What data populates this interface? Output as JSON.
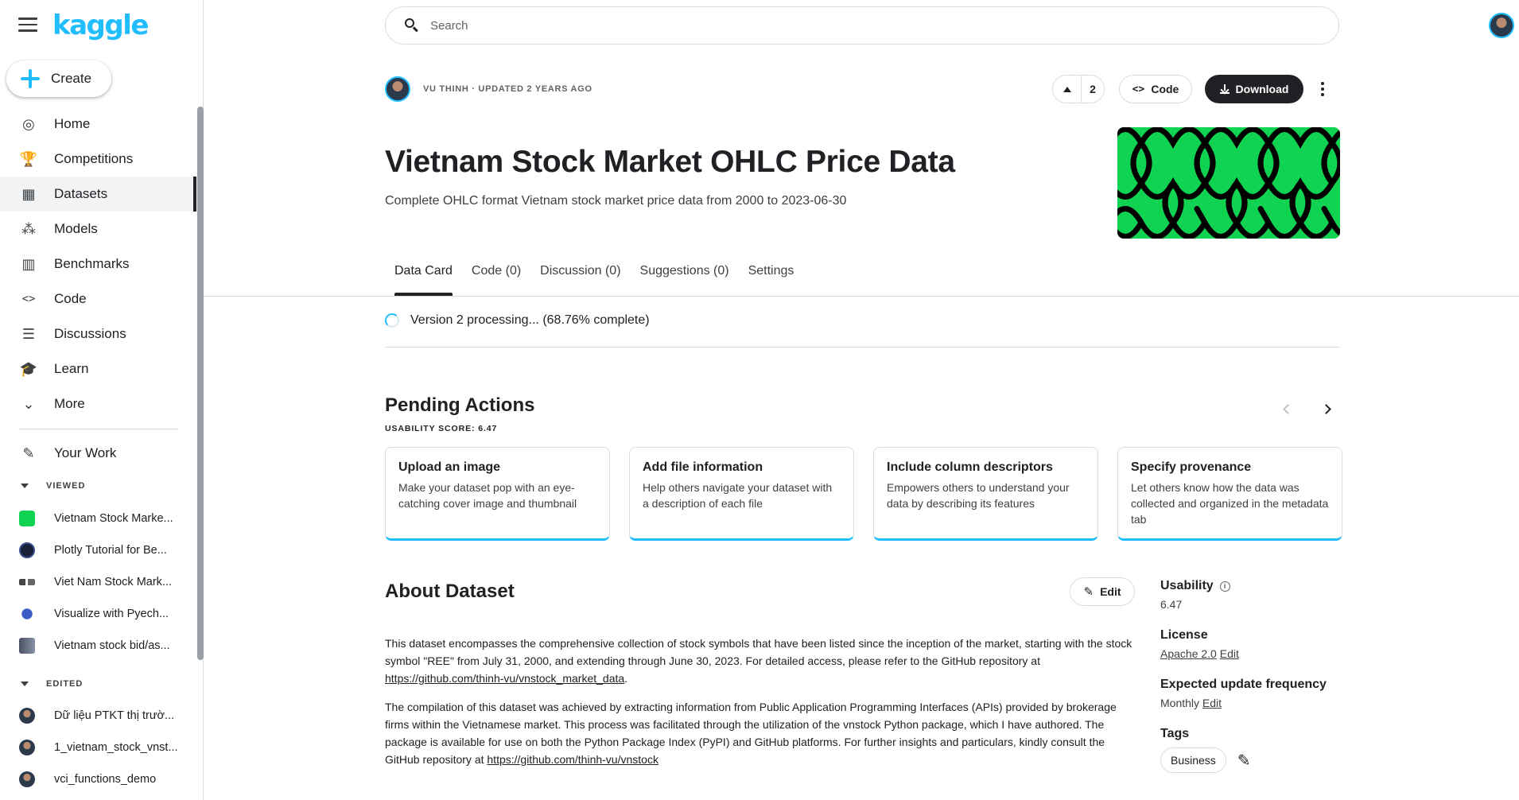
{
  "app": {
    "logo": "kaggle"
  },
  "sidebar": {
    "create_label": "Create",
    "items": [
      {
        "label": "Home",
        "icon": "compass-icon",
        "glyph": "◎"
      },
      {
        "label": "Competitions",
        "icon": "trophy-icon",
        "glyph": "🏆"
      },
      {
        "label": "Datasets",
        "icon": "table-icon",
        "glyph": "▦"
      },
      {
        "label": "Models",
        "icon": "models-icon",
        "glyph": "⁂"
      },
      {
        "label": "Benchmarks",
        "icon": "bar-chart-icon",
        "glyph": "▥"
      },
      {
        "label": "Code",
        "icon": "code-icon",
        "glyph": "<>"
      },
      {
        "label": "Discussions",
        "icon": "discussion-icon",
        "glyph": "☰"
      },
      {
        "label": "Learn",
        "icon": "school-icon",
        "glyph": "🎓"
      },
      {
        "label": "More",
        "icon": "chevron-down-icon",
        "glyph": "⌄"
      }
    ],
    "your_work": {
      "label": "Your Work",
      "icon": "notebook-edit-icon",
      "glyph": "✎"
    },
    "viewed_heading": "VIEWED",
    "viewed": [
      {
        "label": "Vietnam Stock Marke...",
        "color": "#11d352"
      },
      {
        "label": "Plotly Tutorial for Be...",
        "color": "#1a1f3a"
      },
      {
        "label": "Viet Nam Stock Mark...",
        "color": "#444"
      },
      {
        "label": "Visualize with Pyech...",
        "color": "#3b5cc4"
      },
      {
        "label": "Vietnam stock bid/as...",
        "color": "#4a5060"
      }
    ],
    "edited_heading": "EDITED",
    "edited": [
      {
        "label": "Dữ liệu PTKT thị trườ..."
      },
      {
        "label": "1_vietnam_stock_vnst..."
      },
      {
        "label": "vci_functions_demo"
      }
    ]
  },
  "search": {
    "placeholder": "Search"
  },
  "header": {
    "owner_line": "VU THINH · UPDATED 2 YEARS AGO",
    "vote_count": "2",
    "code_label": "Code",
    "download_label": "Download",
    "title": "Vietnam Stock Market OHLC Price Data",
    "subtitle": "Complete OHLC format Vietnam stock market price data from 2000 to 2023-06-30",
    "cover_color": "#11d352"
  },
  "tabs": [
    {
      "label": "Data Card"
    },
    {
      "label": "Code (0)"
    },
    {
      "label": "Discussion (0)"
    },
    {
      "label": "Suggestions (0)"
    },
    {
      "label": "Settings"
    }
  ],
  "processing": {
    "text": "Version 2 processing... (68.76% complete)"
  },
  "pending": {
    "title": "Pending Actions",
    "usability": "USABILITY SCORE: 6.47",
    "cards": [
      {
        "title": "Upload an image",
        "desc": "Make your dataset pop with an eye-catching cover image and thumbnail"
      },
      {
        "title": "Add file information",
        "desc": "Help others navigate your dataset with a description of each file"
      },
      {
        "title": "Include column descriptors",
        "desc": "Empowers others to understand your data by describing its features"
      },
      {
        "title": "Specify provenance",
        "desc": "Let others know how the data was collected and organized in the metadata tab"
      }
    ]
  },
  "about": {
    "title": "About Dataset",
    "edit_label": "Edit",
    "p1": "This dataset encompasses the comprehensive collection of stock symbols that have been listed since the inception of the market, starting with the stock symbol \"REE\" from July 31, 2000, and extending through June 30, 2023. For detailed access, please refer to the GitHub repository at ",
    "p1_link": "https://github.com/thinh-vu/vnstock_market_data",
    "p1_end": ".",
    "p2": "The compilation of this dataset was achieved by extracting information from Public Application Programming Interfaces (APIs) provided by brokerage firms within the Vietnamese market. This process was facilitated through the utilization of the vnstock Python package, which I have authored. The package is available for use on both the Python Package Index (PyPI) and GitHub platforms. For further insights and particulars, kindly consult the GitHub repository at ",
    "p2_link": "https://github.com/thinh-vu/vnstock"
  },
  "meta": {
    "usability_label": "Usability",
    "usability_value": "6.47",
    "license_label": "License",
    "license_value": "Apache 2.0",
    "license_edit": "Edit",
    "frequency_label": "Expected update frequency",
    "frequency_value": "Monthly",
    "frequency_edit": "Edit",
    "tags_label": "Tags",
    "tags": [
      "Business"
    ]
  }
}
